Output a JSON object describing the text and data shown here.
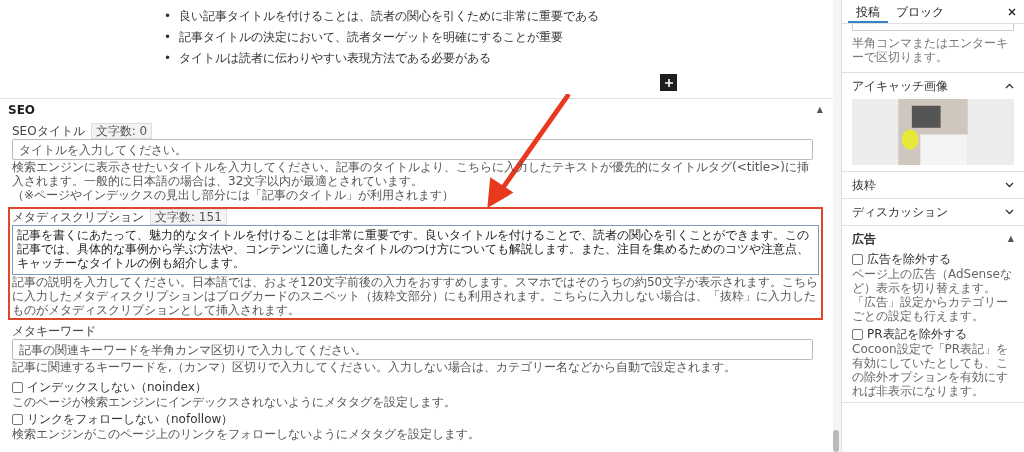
{
  "content": {
    "marker": "•",
    "bullets": [
      "良い記事タイトルを付けることは、読者の関心を引くために非常に重要である",
      "記事タイトルの決定において、読者ターゲットを明確にすることが重要",
      "タイトルは読者に伝わりやすい表現方法である必要がある"
    ]
  },
  "seo": {
    "title": "SEO",
    "expanded": true,
    "caret": "▲",
    "fields": [
      {
        "kind": "input",
        "label": "SEOタイトル",
        "count": "文字数: 0",
        "placeholder": "タイトルを入力してください。",
        "highlighted": false,
        "help": [
          "検索エンジンに表示させたいタイトルを入力してください。記事のタイトルより、こちらに入力したテキストが優先的にタイトルタグ(<title>)に挿入されます。一般的に日本語の場合は、32文字以内が最適とされています。",
          "（※ページやインデックスの見出し部分には「記事のタイトル」が利用されます）"
        ]
      },
      {
        "kind": "textarea",
        "label": "メタディスクリプション",
        "count": "文字数: 151",
        "value": "記事を書くにあたって、魅力的なタイトルを付けることは非常に重要です。良いタイトルを付けることで、読者の関心を引くことができます。この記事では、具体的な事例から学ぶ方法や、コンテンツに適したタイトルのつけ方についても解説します。また、注目を集めるためのコツや注意点、キャッチーなタイトルの例も紹介します。",
        "highlighted": true,
        "help": [
          "記事の説明を入力してください。日本語では、およそ120文字前後の入力をおすすめします。スマホではそのうちの約50文字が表示されます。こちらに入力したメタディスクリプションはブログカードのスニペット（抜粋文部分）にも利用されます。こちらに入力しない場合は、「抜粋」に入力したものがメタディスクリプションとして挿入されます。"
        ]
      },
      {
        "kind": "input",
        "label": "メタキーワード",
        "placeholder": "記事の関連キーワードを半角カンマ区切りで入力してください。",
        "highlighted": false,
        "help": [
          "記事に関連するキーワードを,（カンマ）区切りで入力してください。入力しない場合は、カテゴリー名などから自動で設定されます。"
        ]
      },
      {
        "kind": "checkbox",
        "label": "インデックスしない（noindex）",
        "checked": false,
        "help": [
          "このページが検索エンジンにインデックスされないようにメタタグを設定します。"
        ]
      },
      {
        "kind": "checkbox",
        "label": "リンクをフォローしない（nofollow）",
        "checked": false,
        "help": [
          "検索エンジンがこのページ上のリンクをフォローしないようにメタタグを設定します。"
        ]
      }
    ]
  },
  "sidebar": {
    "tabs": [
      {
        "label": "投稿",
        "selected": true
      },
      {
        "label": "ブロック",
        "selected": false
      }
    ],
    "tag_help": "半角コンマまたはエンターキーで区切ります。",
    "panels": [
      {
        "kind": "image",
        "title": "アイキャッチ画像",
        "expanded": true
      },
      {
        "kind": "plain",
        "title": "抜粋",
        "expanded": false
      },
      {
        "kind": "plain",
        "title": "ディスカッション",
        "expanded": false
      },
      {
        "kind": "options",
        "title": "広告",
        "expanded": true,
        "caret": "▲",
        "options": [
          {
            "label": "広告を除外する",
            "checked": false,
            "help": "ページ上の広告（AdSenseなど）表示を切り替えます。「広告」設定からカテゴリーごとの設定も行えます。"
          },
          {
            "label": "PR表記を除外する",
            "checked": false,
            "help": "Cocoon設定で「PR表記」を有効にしていたとしても、この除外オプションを有効にすれば非表示になります。"
          }
        ]
      }
    ]
  }
}
